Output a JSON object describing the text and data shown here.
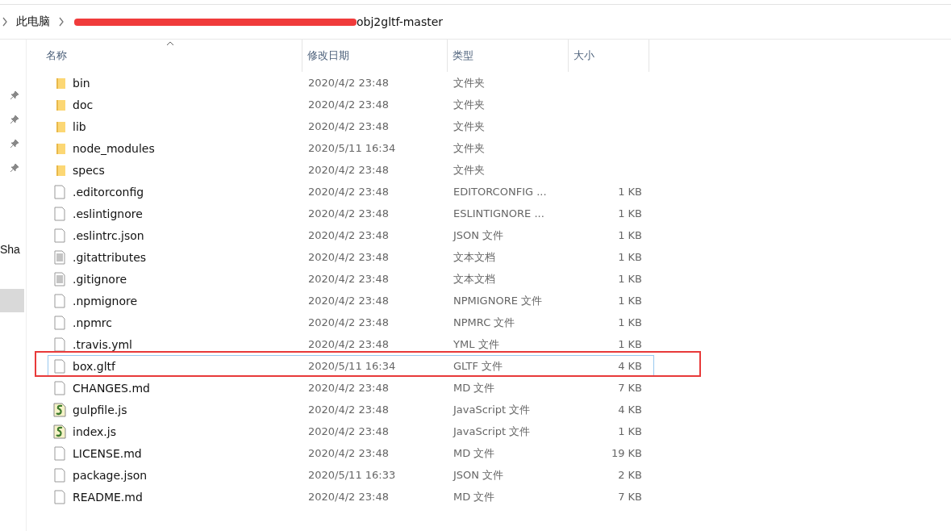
{
  "breadcrumb": {
    "items": [
      {
        "label": "此电脑"
      },
      {
        "label": "obj2gltf-master",
        "redacted_before": true
      }
    ]
  },
  "nav": {
    "label": "Sha"
  },
  "table": {
    "columns": [
      {
        "label": "名称",
        "sorted": true
      },
      {
        "label": "修改日期",
        "sorted": false
      },
      {
        "label": "类型",
        "sorted": false
      },
      {
        "label": "大小",
        "sorted": false
      }
    ],
    "rows": [
      {
        "kind": "folder",
        "name": "bin",
        "date": "2020/4/2 23:48",
        "type": "文件夹",
        "highlighted": false
      },
      {
        "kind": "folder",
        "name": "doc",
        "date": "2020/4/2 23:48",
        "type": "文件夹",
        "highlighted": false
      },
      {
        "kind": "folder",
        "name": "lib",
        "date": "2020/4/2 23:48",
        "type": "文件夹",
        "highlighted": false
      },
      {
        "kind": "folder",
        "name": "node_modules",
        "date": "2020/5/11 16:34",
        "type": "文件夹",
        "highlighted": false
      },
      {
        "kind": "folder",
        "name": "specs",
        "date": "2020/4/2 23:48",
        "type": "文件夹",
        "highlighted": false
      },
      {
        "kind": "file",
        "name": ".editorconfig",
        "date": "2020/4/2 23:48",
        "type": "EDITORCONFIG ...",
        "size": "1 KB",
        "highlighted": false
      },
      {
        "kind": "file",
        "name": ".eslintignore",
        "date": "2020/4/2 23:48",
        "type": "ESLINTIGNORE ...",
        "size": "1 KB",
        "highlighted": false
      },
      {
        "kind": "file",
        "name": ".eslintrc.json",
        "date": "2020/4/2 23:48",
        "type": "JSON 文件",
        "size": "1 KB",
        "highlighted": false
      },
      {
        "kind": "text",
        "name": ".gitattributes",
        "date": "2020/4/2 23:48",
        "type": "文本文档",
        "size": "1 KB",
        "highlighted": false
      },
      {
        "kind": "text",
        "name": ".gitignore",
        "date": "2020/4/2 23:48",
        "type": "文本文档",
        "size": "1 KB",
        "highlighted": false
      },
      {
        "kind": "file",
        "name": ".npmignore",
        "date": "2020/4/2 23:48",
        "type": "NPMIGNORE 文件",
        "size": "1 KB",
        "highlighted": false
      },
      {
        "kind": "file",
        "name": ".npmrc",
        "date": "2020/4/2 23:48",
        "type": "NPMRC 文件",
        "size": "1 KB",
        "highlighted": false
      },
      {
        "kind": "file",
        "name": ".travis.yml",
        "date": "2020/4/2 23:48",
        "type": "YML 文件",
        "size": "1 KB",
        "highlighted": false
      },
      {
        "kind": "file",
        "name": "box.gltf",
        "date": "2020/5/11 16:34",
        "type": "GLTF 文件",
        "size": "4 KB",
        "highlighted": true
      },
      {
        "kind": "file",
        "name": "CHANGES.md",
        "date": "2020/4/2 23:48",
        "type": "MD 文件",
        "size": "7 KB",
        "highlighted": false
      },
      {
        "kind": "script",
        "name": "gulpfile.js",
        "date": "2020/4/2 23:48",
        "type": "JavaScript 文件",
        "size": "4 KB",
        "highlighted": false
      },
      {
        "kind": "script",
        "name": "index.js",
        "date": "2020/4/2 23:48",
        "type": "JavaScript 文件",
        "size": "1 KB",
        "highlighted": false
      },
      {
        "kind": "file",
        "name": "LICENSE.md",
        "date": "2020/4/2 23:48",
        "type": "MD 文件",
        "size": "19 KB",
        "highlighted": false
      },
      {
        "kind": "file",
        "name": "package.json",
        "date": "2020/5/11 16:33",
        "type": "JSON 文件",
        "size": "2 KB",
        "highlighted": false
      },
      {
        "kind": "file",
        "name": "README.md",
        "date": "2020/4/2 23:48",
        "type": "MD 文件",
        "size": "7 KB",
        "highlighted": false
      }
    ]
  }
}
